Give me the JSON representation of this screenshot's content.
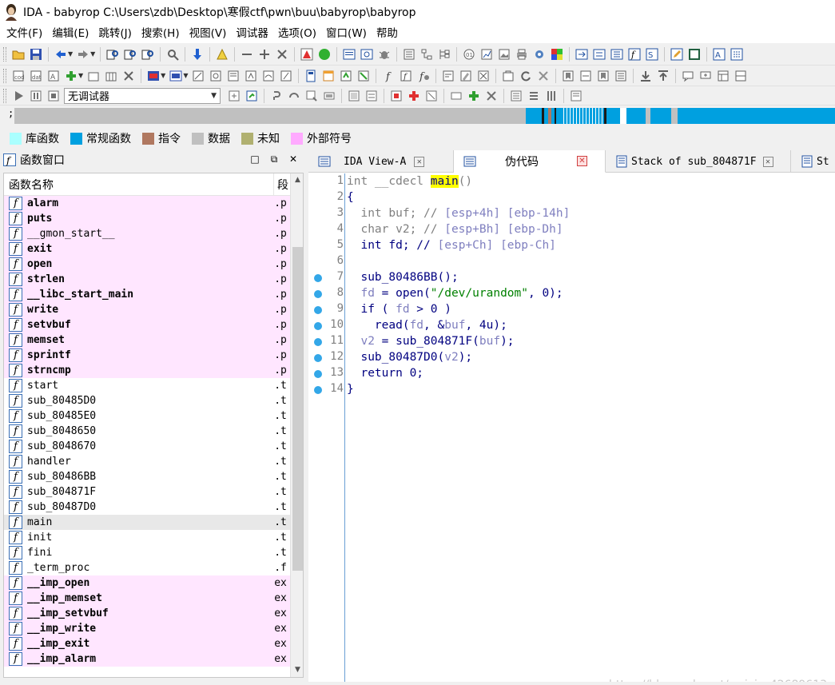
{
  "window": {
    "title": "IDA - babyrop C:\\Users\\zdb\\Desktop\\寒假ctf\\pwn\\buu\\babyrop\\babyrop"
  },
  "menu": [
    {
      "label": "文件(F)"
    },
    {
      "label": "编辑(E)"
    },
    {
      "label": "跳转(J)"
    },
    {
      "label": "搜索(H)"
    },
    {
      "label": "视图(V)"
    },
    {
      "label": "调试器"
    },
    {
      "label": "选项(O)"
    },
    {
      "label": "窗口(W)"
    },
    {
      "label": "帮助"
    }
  ],
  "toolbar": {
    "debugger_select": "无调试器",
    "nav_prefix": ";"
  },
  "legend": [
    {
      "label": "库函数",
      "color": "#aaffff"
    },
    {
      "label": "常规函数",
      "color": "#00a0e0"
    },
    {
      "label": "指令",
      "color": "#b07860"
    },
    {
      "label": "数据",
      "color": "#c0c0c0"
    },
    {
      "label": "未知",
      "color": "#b0b070"
    },
    {
      "label": "外部符号",
      "color": "#ffaaff"
    }
  ],
  "functions_window": {
    "title": "函数窗口",
    "col_name": "函数名称",
    "col_segment": "段",
    "rows": [
      {
        "name": "alarm",
        "segment": ".p",
        "kind": "lib"
      },
      {
        "name": "puts",
        "segment": ".p",
        "kind": "lib"
      },
      {
        "name": "__gmon_start__",
        "segment": ".p",
        "kind": "lib-plain"
      },
      {
        "name": "exit",
        "segment": ".p",
        "kind": "lib"
      },
      {
        "name": "open",
        "segment": ".p",
        "kind": "lib"
      },
      {
        "name": "strlen",
        "segment": ".p",
        "kind": "lib"
      },
      {
        "name": "__libc_start_main",
        "segment": ".p",
        "kind": "lib"
      },
      {
        "name": "write",
        "segment": ".p",
        "kind": "lib"
      },
      {
        "name": "setvbuf",
        "segment": ".p",
        "kind": "lib"
      },
      {
        "name": "memset",
        "segment": ".p",
        "kind": "lib"
      },
      {
        "name": "sprintf",
        "segment": ".p",
        "kind": "lib"
      },
      {
        "name": "strncmp",
        "segment": ".p",
        "kind": "lib"
      },
      {
        "name": "start",
        "segment": ".t",
        "kind": "normal"
      },
      {
        "name": "sub_80485D0",
        "segment": ".t",
        "kind": "normal"
      },
      {
        "name": "sub_80485E0",
        "segment": ".t",
        "kind": "normal"
      },
      {
        "name": "sub_8048650",
        "segment": ".t",
        "kind": "normal"
      },
      {
        "name": "sub_8048670",
        "segment": ".t",
        "kind": "normal"
      },
      {
        "name": "handler",
        "segment": ".t",
        "kind": "normal"
      },
      {
        "name": "sub_80486BB",
        "segment": ".t",
        "kind": "normal"
      },
      {
        "name": "sub_804871F",
        "segment": ".t",
        "kind": "normal"
      },
      {
        "name": "sub_80487D0",
        "segment": ".t",
        "kind": "normal"
      },
      {
        "name": "main",
        "segment": ".t",
        "kind": "selected"
      },
      {
        "name": "init",
        "segment": ".t",
        "kind": "normal"
      },
      {
        "name": "fini",
        "segment": ".t",
        "kind": "normal"
      },
      {
        "name": "_term_proc",
        "segment": ".f",
        "kind": "normal"
      },
      {
        "name": "__imp_open",
        "segment": "ex",
        "kind": "lib"
      },
      {
        "name": "__imp_memset",
        "segment": "ex",
        "kind": "lib"
      },
      {
        "name": "__imp_setvbuf",
        "segment": "ex",
        "kind": "lib"
      },
      {
        "name": "__imp_write",
        "segment": "ex",
        "kind": "lib"
      },
      {
        "name": "__imp_exit",
        "segment": "ex",
        "kind": "lib"
      },
      {
        "name": "__imp_alarm",
        "segment": "ex",
        "kind": "lib"
      }
    ]
  },
  "tabs": [
    {
      "label": "IDA View-A",
      "active": false
    },
    {
      "label": "伪代码",
      "active": true
    },
    {
      "label": "Stack of sub_804871F",
      "active": false
    },
    {
      "label": "St",
      "active": false
    }
  ],
  "pseudocode": {
    "lines": [
      {
        "num": "1",
        "bp": false
      },
      {
        "num": "2",
        "bp": false
      },
      {
        "num": "3",
        "bp": false
      },
      {
        "num": "4",
        "bp": false
      },
      {
        "num": "5",
        "bp": false
      },
      {
        "num": "6",
        "bp": false
      },
      {
        "num": "7",
        "bp": true
      },
      {
        "num": "8",
        "bp": true
      },
      {
        "num": "9",
        "bp": true
      },
      {
        "num": "10",
        "bp": true
      },
      {
        "num": "11",
        "bp": true
      },
      {
        "num": "12",
        "bp": true
      },
      {
        "num": "13",
        "bp": true
      },
      {
        "num": "14",
        "bp": true
      }
    ],
    "tokens": {
      "l1_a": "int __cdecl ",
      "l1_b": "main",
      "l1_c": "()",
      "l2": "{",
      "l3_a": "  int buf; // ",
      "l3_b": "[esp+4h] [ebp-14h]",
      "l4_a": "  char v2; // ",
      "l4_b": "[esp+Bh] [ebp-Dh]",
      "l5_a": "  int fd; // ",
      "l5_b": "[esp+Ch] [ebp-Ch]",
      "l7": "  sub_80486BB();",
      "l8_a": "  fd",
      "l8_b": " = open(",
      "l8_c": "\"/dev/urandom\"",
      "l8_d": ", 0);",
      "l9_a": "  if ( ",
      "l9_b": "fd",
      "l9_c": " > 0 )",
      "l10_a": "    read(",
      "l10_b": "fd",
      "l10_c": ", &",
      "l10_d": "buf",
      "l10_e": ", 4u);",
      "l11_a": "  v2",
      "l11_b": " = sub_804871F(",
      "l11_c": "buf",
      "l11_d": ");",
      "l12_a": "  sub_80487D0(",
      "l12_b": "v2",
      "l12_c": ");",
      "l13": "  return 0;",
      "l14": "}"
    }
  },
  "watermark": "https://blog.csdn.net/weixin_42689613"
}
